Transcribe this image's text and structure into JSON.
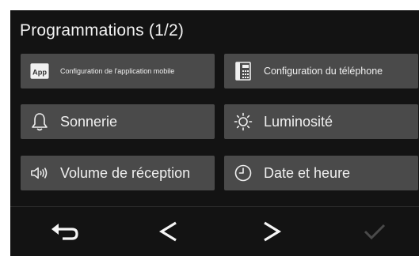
{
  "title": "Programmations (1/2)",
  "tiles": [
    {
      "label": "Configuration de l'application mobile",
      "icon": "app-icon"
    },
    {
      "label": "Configuration du téléphone",
      "icon": "phone-icon"
    },
    {
      "label": "Sonnerie",
      "icon": "bell-icon"
    },
    {
      "label": "Luminosité",
      "icon": "brightness-icon"
    },
    {
      "label": "Volume de réception",
      "icon": "speaker-icon"
    },
    {
      "label": "Date et heure",
      "icon": "clock-icon"
    }
  ],
  "app_icon_text": "App",
  "nav": {
    "back_icon": "return-icon",
    "prev_glyph": "<",
    "next_glyph": ">",
    "confirm_icon": "checkmark-icon"
  },
  "colors": {
    "background": "#131313",
    "tile": "#4a4a4a",
    "text": "#f0f0f0",
    "disabled": "#4a4a4a"
  }
}
